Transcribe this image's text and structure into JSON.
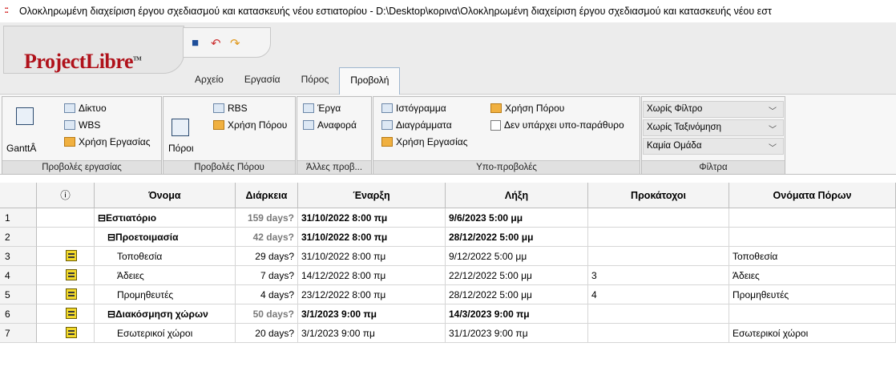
{
  "window": {
    "title": "Ολοκληρωμένη διαχείριση έργου σχεδιασμού και κατασκευής νέου εστιατορίου - D:\\Desktop\\κορινα\\Ολοκληρωμένη διαχείριση έργου σχεδιασμού και κατασκευής νέου εστ"
  },
  "app": {
    "logo": "ProjectLibre",
    "logo_mark": "TM"
  },
  "menu_tabs": [
    "Αρχείο",
    "Εργασία",
    "Πόρος",
    "Προβολή"
  ],
  "ribbon": {
    "task_views": {
      "label": "Προβολές εργασίας",
      "gantt": "GanttÂ",
      "items": [
        "Δίκτυο",
        "WBS",
        "Χρήση Εργασίας"
      ]
    },
    "resource_views": {
      "label": "Προβολές Πόρου",
      "resources": "Πόροι",
      "items": [
        "RBS",
        "Χρήση Πόρου"
      ]
    },
    "other_views": {
      "label": "Άλλες προβ...",
      "items": [
        "Έργα",
        "Αναφορά"
      ]
    },
    "sub_views": {
      "label": "Υπο-προβολές",
      "items": [
        "Ιστόγραμμα",
        "Διαγράμματα",
        "Χρήση Εργασίας"
      ],
      "items2": [
        "Χρήση Πόρου",
        "Δεν υπάρχει υπο-παράθυρο"
      ]
    },
    "filters": {
      "label": "Φίλτρα",
      "filter": "Χωρίς Φίλτρο",
      "sort": "Χωρίς Ταξινόμηση",
      "group": "Καμία Ομάδα"
    }
  },
  "table": {
    "headers": [
      "",
      "ⓘ",
      "Όνομα",
      "Διάρκεια",
      "Έναρξη",
      "Λήξη",
      "Προκάτοχοι",
      "Ονόματα Πόρων"
    ],
    "rows": [
      {
        "n": "1",
        "icon": false,
        "name": "⊟Εστιατόριο",
        "dur": "159 days?",
        "start": "31/10/2022 8:00 πμ",
        "end": "9/6/2023 5:00 μμ",
        "pred": "",
        "res": "",
        "summary": true,
        "indent": 0
      },
      {
        "n": "2",
        "icon": false,
        "name": "⊟Προετοιμασία",
        "dur": "42 days?",
        "start": "31/10/2022 8:00 πμ",
        "end": "28/12/2022 5:00 μμ",
        "pred": "",
        "res": "",
        "summary": true,
        "indent": 1
      },
      {
        "n": "3",
        "icon": true,
        "name": "Τοποθεσία",
        "dur": "29 days?",
        "start": "31/10/2022 8:00 πμ",
        "end": "9/12/2022 5:00 μμ",
        "pred": "",
        "res": "Τοποθεσία",
        "summary": false,
        "indent": 2
      },
      {
        "n": "4",
        "icon": true,
        "name": "Άδειες",
        "dur": "7 days?",
        "start": "14/12/2022 8:00 πμ",
        "end": "22/12/2022 5:00 μμ",
        "pred": "3",
        "res": "Άδειες",
        "summary": false,
        "indent": 2
      },
      {
        "n": "5",
        "icon": true,
        "name": "Προμηθευτές",
        "dur": "4 days?",
        "start": "23/12/2022 8:00 πμ",
        "end": "28/12/2022 5:00 μμ",
        "pred": "4",
        "res": "Προμηθευτές",
        "summary": false,
        "indent": 2
      },
      {
        "n": "6",
        "icon": true,
        "name": "⊟Διακόσμηση χώρων",
        "dur": "50 days?",
        "start": "3/1/2023 9:00 πμ",
        "end": "14/3/2023 9:00 πμ",
        "pred": "",
        "res": "",
        "summary": true,
        "indent": 1
      },
      {
        "n": "7",
        "icon": true,
        "name": "Εσωτερικοί χώροι",
        "dur": "20 days?",
        "start": "3/1/2023 9:00 πμ",
        "end": "31/1/2023 9:00 πμ",
        "pred": "",
        "res": "Εσωτερικοί χώροι",
        "summary": false,
        "indent": 2
      }
    ]
  }
}
